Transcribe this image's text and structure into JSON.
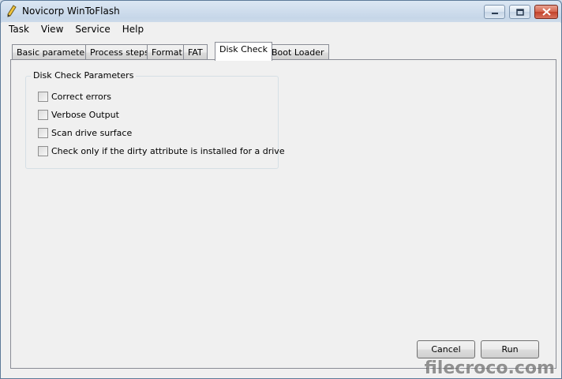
{
  "window": {
    "title": "Novicorp WinToFlash",
    "controls": {
      "minimize": "–",
      "maximize": "□",
      "close": "✕"
    }
  },
  "menu": [
    "Task",
    "View",
    "Service",
    "Help"
  ],
  "tabs": [
    {
      "label": "Basic parameters",
      "active": false
    },
    {
      "label": "Process steps",
      "active": false
    },
    {
      "label": "Format",
      "active": false
    },
    {
      "label": "FAT",
      "active": false
    },
    {
      "label": "Disk Check",
      "active": true
    },
    {
      "label": "Boot Loader",
      "active": false
    }
  ],
  "disk_check": {
    "group_title": "Disk Check Parameters",
    "options": [
      {
        "label": "Correct errors",
        "checked": false
      },
      {
        "label": "Verbose Output",
        "checked": false
      },
      {
        "label": "Scan drive surface",
        "checked": false
      },
      {
        "label": "Check only if the dirty attribute is installed for a drive",
        "checked": false
      }
    ]
  },
  "buttons": {
    "cancel": "Cancel",
    "run": "Run"
  },
  "watermark": "filecroco.com",
  "colors": {
    "close_button": "#c2412a",
    "title_gradient": "#c6d6e8"
  }
}
